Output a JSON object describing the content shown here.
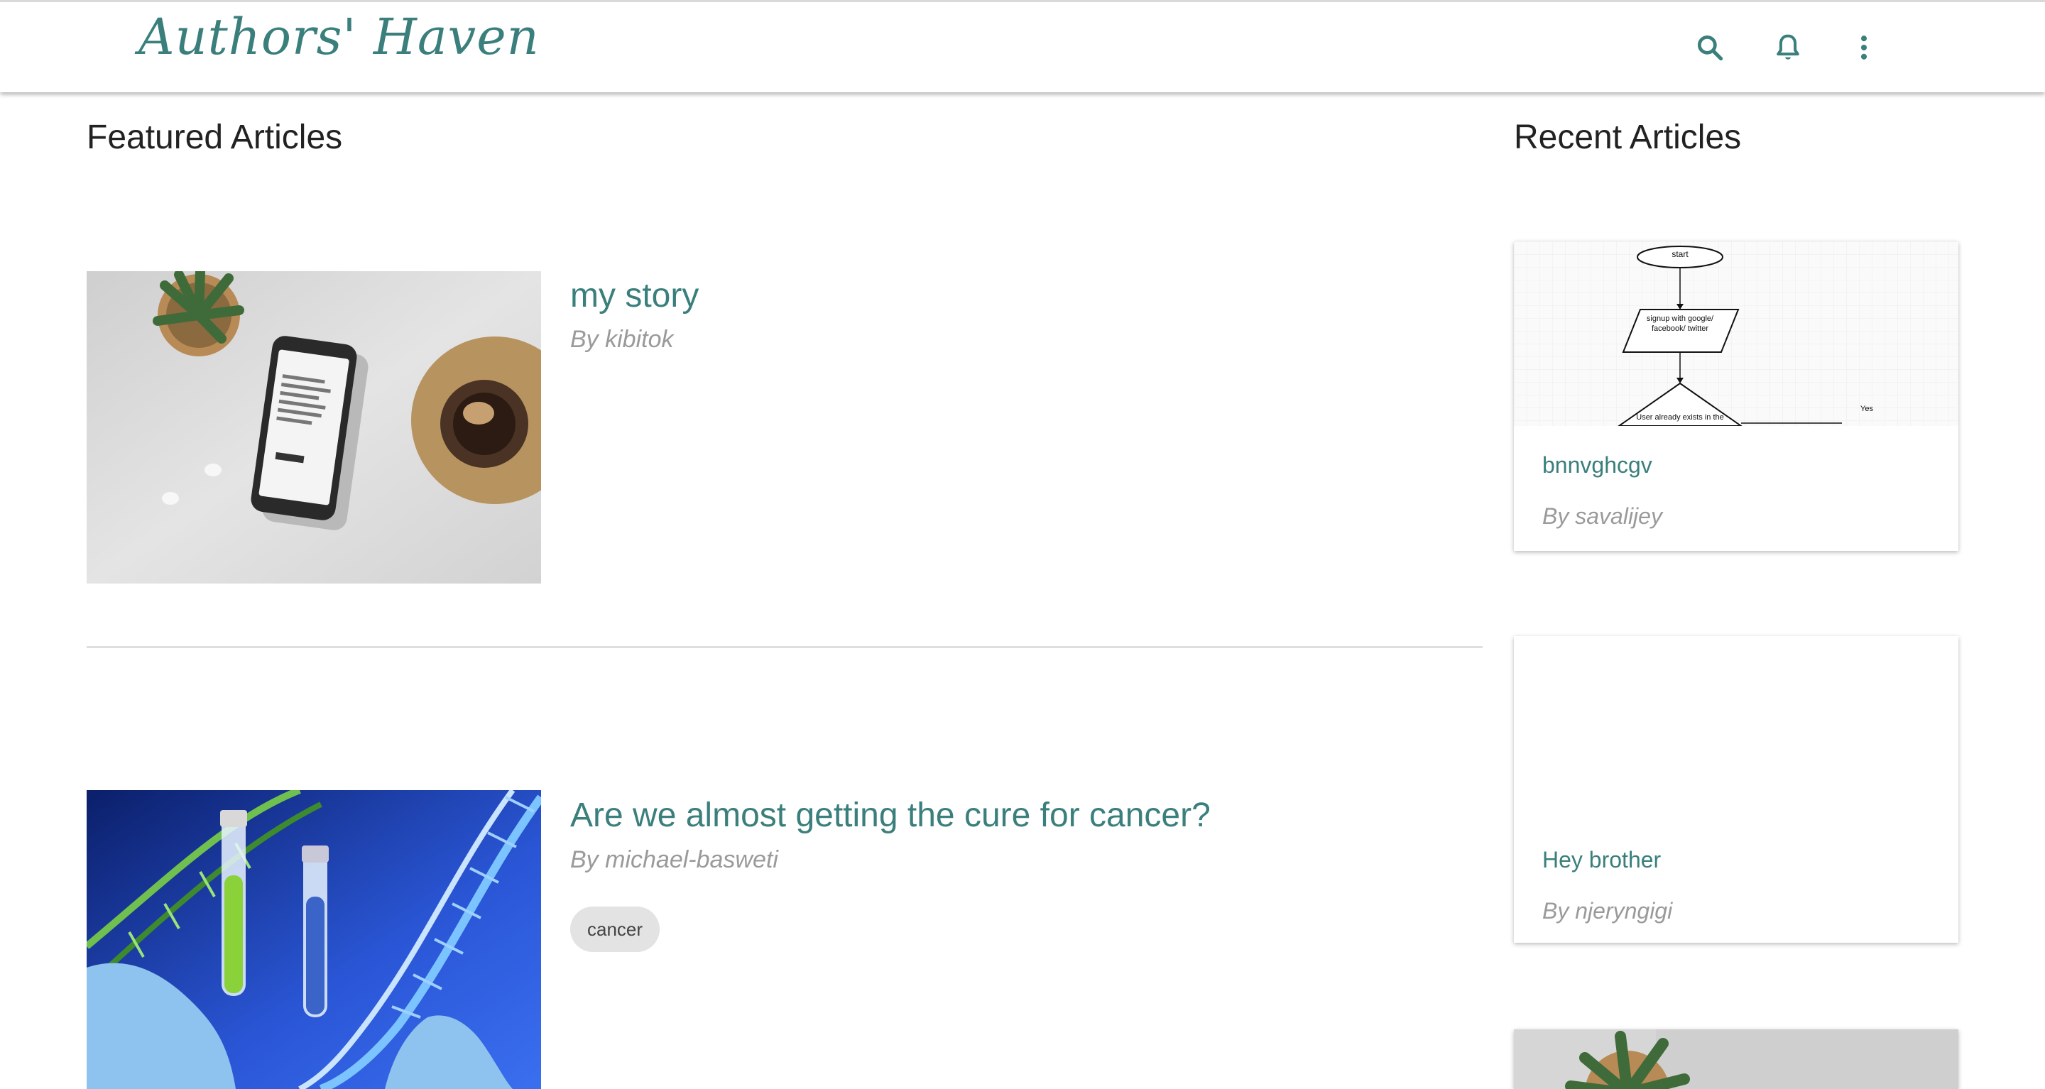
{
  "header": {
    "logo": "Authors' Haven",
    "icons": [
      "search-icon",
      "bell-icon",
      "more-vert-icon"
    ],
    "accent": "#3a7f7c"
  },
  "featured": {
    "title": "Featured Articles",
    "articles": [
      {
        "title": "my story",
        "author": "By kibitok",
        "tags": []
      },
      {
        "title": "Are we almost getting the cure for cancer?",
        "author": "By michael-basweti",
        "tags": [
          "cancer"
        ]
      }
    ]
  },
  "recent": {
    "title": "Recent Articles",
    "cards": [
      {
        "title": "bnnvghcgv",
        "author": "By savalijey",
        "flowchart": {
          "start": "start",
          "step": "signup with google/ facebook/ twitter",
          "decision": "User already exists in the",
          "yes": "Yes"
        }
      },
      {
        "title": "Hey brother",
        "author": "By njeryngigi"
      },
      {
        "title": "",
        "author": ""
      }
    ]
  }
}
